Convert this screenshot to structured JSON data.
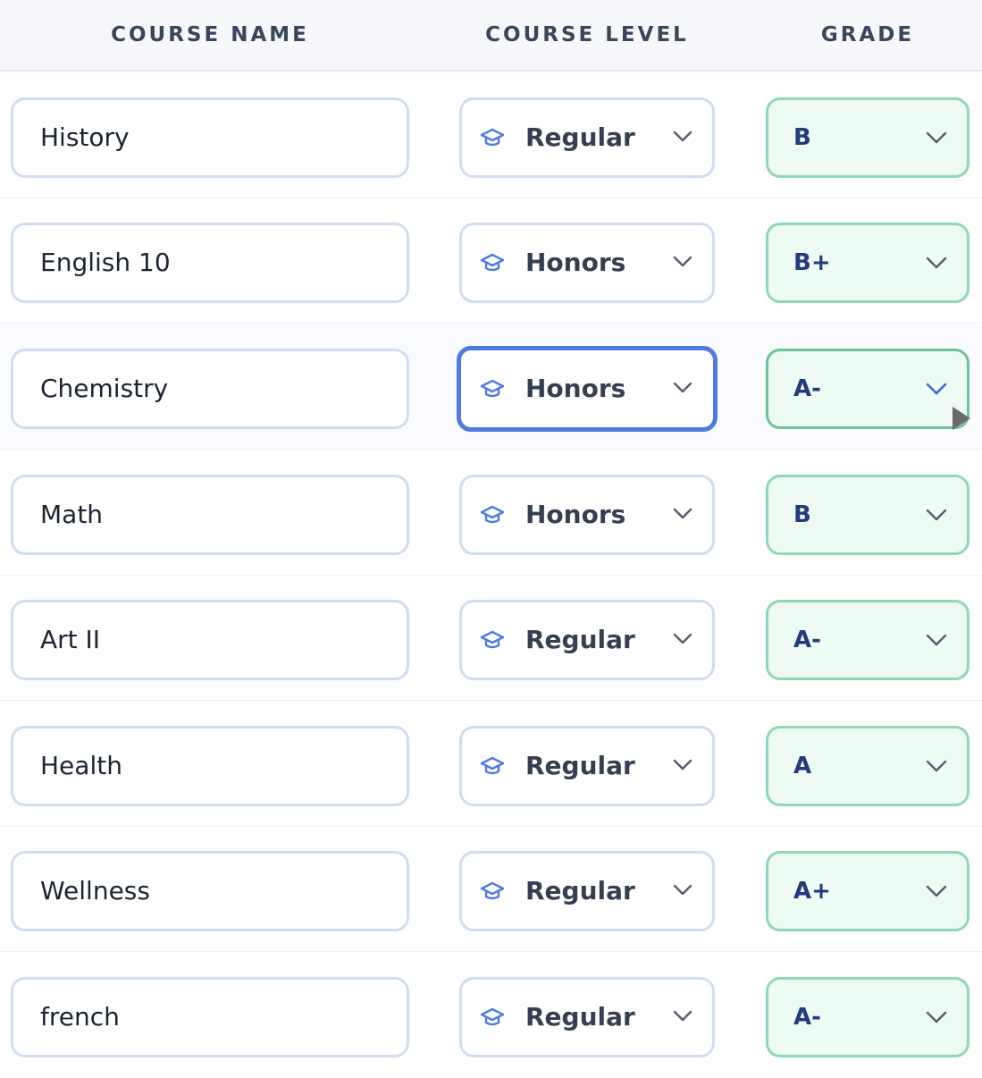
{
  "header": {
    "course_name": "COURSE NAME",
    "course_level": "COURSE LEVEL",
    "grade": "GRADE"
  },
  "colors": {
    "focus_border": "#4f7be0",
    "grade_border": "#8fd8b5",
    "grade_background": "#eefaf4",
    "grade_text": "#233a7d",
    "input_border": "#cfdcf2"
  },
  "icons": {
    "level": "graduation-cap-icon",
    "dropdown": "chevron-down-icon"
  },
  "courses": [
    {
      "name": "History",
      "level": "Regular",
      "grade": "B"
    },
    {
      "name": "English 10",
      "level": "Honors",
      "grade": "B+"
    },
    {
      "name": "Chemistry",
      "level": "Honors",
      "grade": "A-"
    },
    {
      "name": "Math",
      "level": "Honors",
      "grade": "B"
    },
    {
      "name": "Art II",
      "level": "Regular",
      "grade": "A-"
    },
    {
      "name": "Health",
      "level": "Regular",
      "grade": "A"
    },
    {
      "name": "Wellness",
      "level": "Regular",
      "grade": "A+"
    },
    {
      "name": "french",
      "level": "Regular",
      "grade": "A-"
    }
  ]
}
